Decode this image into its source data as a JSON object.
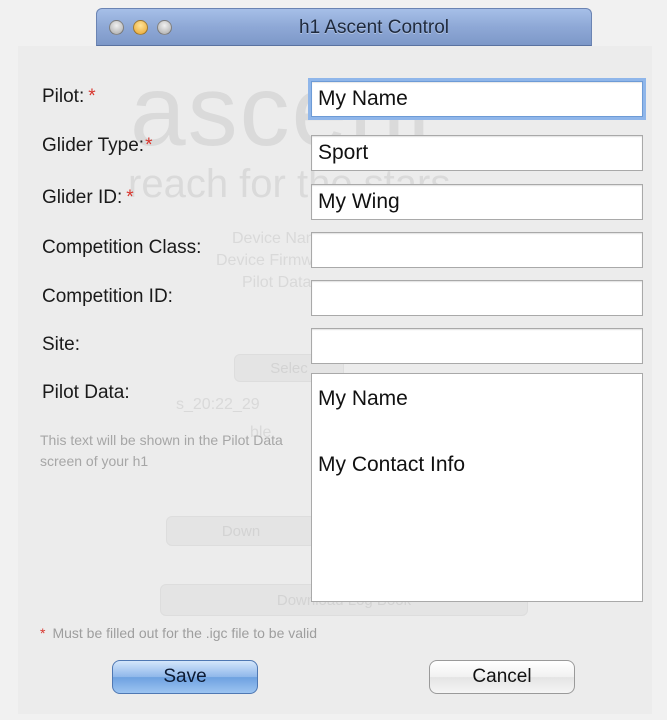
{
  "window": {
    "title": "h1 Ascent Control"
  },
  "background": {
    "logo_text": "ascent",
    "tagline": "reach for the stars",
    "ghost_rows": [
      "Device Name",
      "Device Firmware Vers.",
      "Pilot Data",
      "Selec",
      "s_20:22_29",
      "ble",
      "Down",
      "Download Log Book"
    ]
  },
  "form": {
    "pilot": {
      "label": "Pilot:",
      "value": "My Name",
      "required_mark": "*"
    },
    "glider_type": {
      "label": "Glider Type:",
      "value": "Sport",
      "required_mark": "*"
    },
    "glider_id": {
      "label": "Glider ID:",
      "value": "My Wing",
      "required_mark": "*"
    },
    "competition_class": {
      "label": "Competition Class:",
      "value": ""
    },
    "competition_id": {
      "label": "Competition ID:",
      "value": ""
    },
    "site": {
      "label": "Site:",
      "value": ""
    },
    "pilot_data": {
      "label": "Pilot Data:",
      "value": "My Name\n\nMy Contact Info",
      "hint": "This text will be shown in the Pilot Data screen of your h1"
    }
  },
  "footnote": {
    "star": "*",
    "text": "Must be filled out for the .igc file to be valid"
  },
  "buttons": {
    "save": "Save",
    "cancel": "Cancel"
  },
  "colors": {
    "accent": "#6ea1e0",
    "required": "#d8362e",
    "titlebar": "#8ea8d6"
  }
}
